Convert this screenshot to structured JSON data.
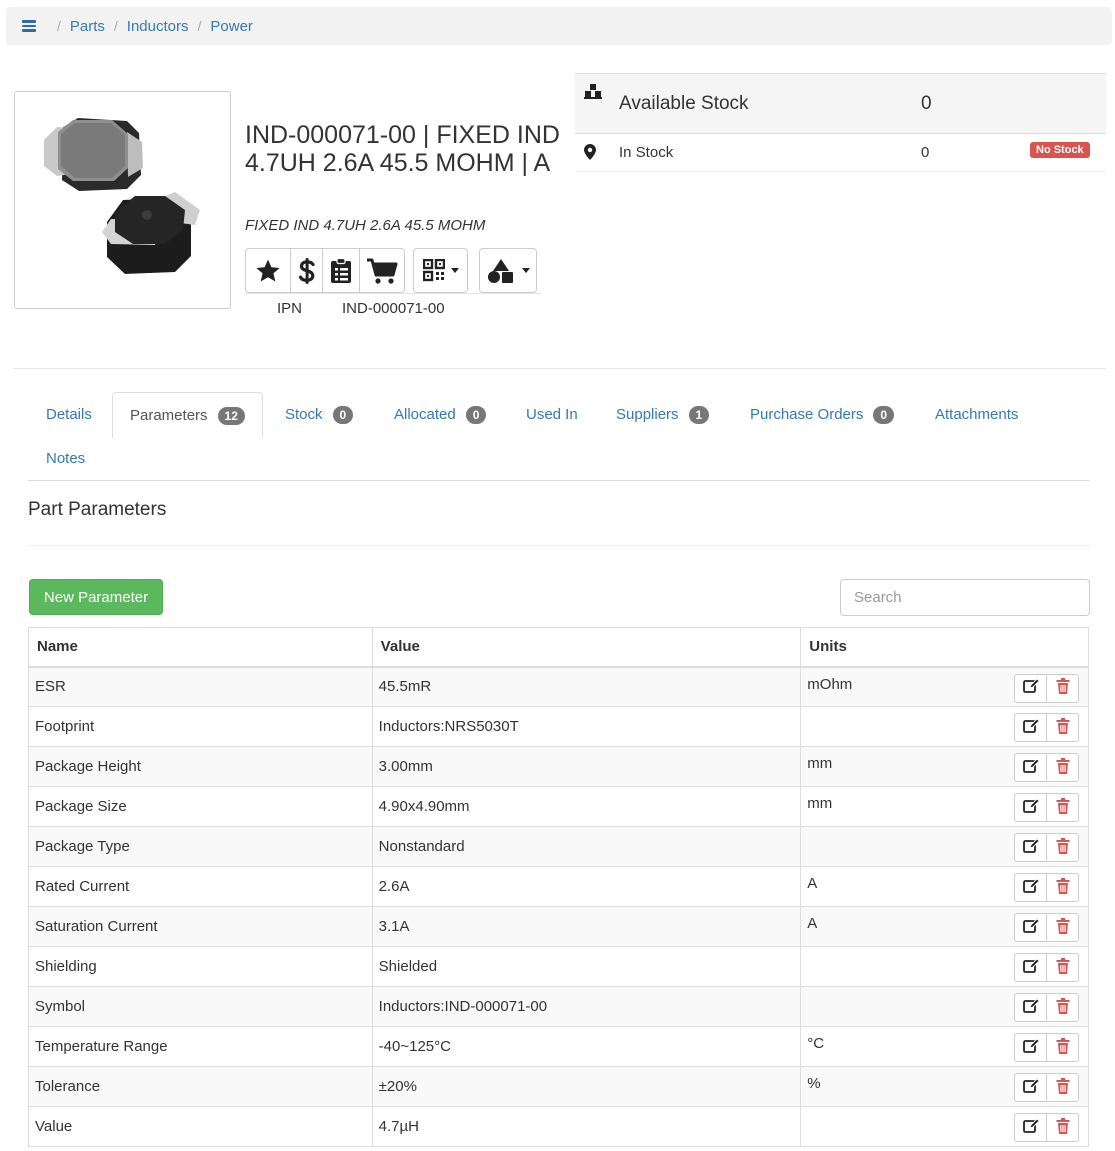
{
  "breadcrumb": {
    "items": [
      "Parts",
      "Inductors",
      "Power"
    ]
  },
  "part": {
    "title": "IND-000071-00 | FIXED IND 4.7UH 2.6A 45.5 MOHM | A",
    "description": "FIXED IND 4.7UH 2.6A 45.5 MOHM",
    "ipn_label": "IPN",
    "ipn_value": "IND-000071-00"
  },
  "stock": {
    "available_label": "Available Stock",
    "available_value": "0",
    "in_stock_label": "In Stock",
    "in_stock_value": "0",
    "no_stock_badge": "No Stock"
  },
  "tabs": [
    {
      "label": "Details",
      "badge": null
    },
    {
      "label": "Parameters",
      "badge": "12"
    },
    {
      "label": "Stock",
      "badge": "0"
    },
    {
      "label": "Allocated",
      "badge": "0"
    },
    {
      "label": "Used In",
      "badge": null
    },
    {
      "label": "Suppliers",
      "badge": "1"
    },
    {
      "label": "Purchase Orders",
      "badge": "0"
    },
    {
      "label": "Attachments",
      "badge": null
    },
    {
      "label": "Notes",
      "badge": null
    }
  ],
  "section": {
    "title": "Part Parameters",
    "new_button": "New Parameter",
    "search_placeholder": "Search"
  },
  "table": {
    "columns": [
      "Name",
      "Value",
      "Units"
    ],
    "rows": [
      {
        "name": "ESR",
        "value": "45.5mR",
        "units": "mOhm"
      },
      {
        "name": "Footprint",
        "value": "Inductors:NRS5030T",
        "units": ""
      },
      {
        "name": "Package Height",
        "value": "3.00mm",
        "units": "mm"
      },
      {
        "name": "Package Size",
        "value": "4.90x4.90mm",
        "units": "mm"
      },
      {
        "name": "Package Type",
        "value": "Nonstandard",
        "units": ""
      },
      {
        "name": "Rated Current",
        "value": "2.6A",
        "units": "A"
      },
      {
        "name": "Saturation Current",
        "value": "3.1A",
        "units": "A"
      },
      {
        "name": "Shielding",
        "value": "Shielded",
        "units": ""
      },
      {
        "name": "Symbol",
        "value": "Inductors:IND-000071-00",
        "units": ""
      },
      {
        "name": "Temperature Range",
        "value": "-40~125°C",
        "units": "°C"
      },
      {
        "name": "Tolerance",
        "value": "±20%",
        "units": "%"
      },
      {
        "name": "Value",
        "value": "4.7µH",
        "units": ""
      }
    ]
  },
  "colors": {
    "link": "#337ab7",
    "success": "#5cb85c",
    "danger": "#d9534f",
    "badge": "#777777"
  },
  "icons": [
    "menu-icon",
    "star-icon",
    "dollar-icon",
    "clipboard-icon",
    "cart-icon",
    "qrcode-icon",
    "shapes-icon",
    "boxes-icon",
    "map-marker-icon",
    "edit-icon",
    "trash-icon"
  ]
}
